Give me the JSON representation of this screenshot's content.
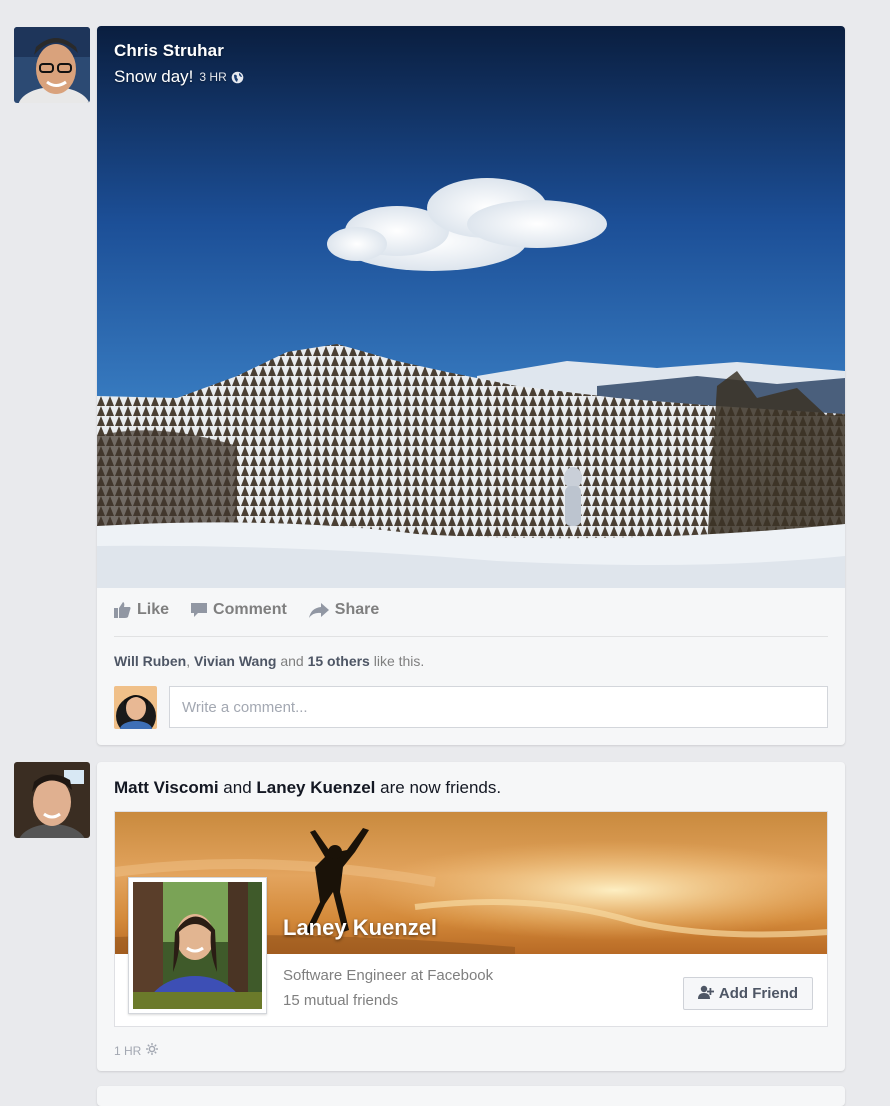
{
  "feed": {
    "story1": {
      "author": "Chris Struhar",
      "status": "Snow day!",
      "time": "3 HR",
      "privacy_icon": "globe-icon",
      "actions": {
        "like": "Like",
        "comment": "Comment",
        "share": "Share"
      },
      "likes": {
        "name1": "Will Ruben",
        "sep": ", ",
        "name2": "Vivian Wang",
        "and": " and ",
        "others": "15 others",
        "suffix": " like this."
      },
      "comment_placeholder": "Write a comment..."
    },
    "story2": {
      "actor1": "Matt Viscomi",
      "connector": " and ",
      "actor2": "Laney Kuenzel",
      "suffix": " are now friends.",
      "friend": {
        "name": "Laney Kuenzel",
        "job": "Software Engineer at Facebook",
        "mutual": "15 mutual friends",
        "add_label": "Add Friend"
      },
      "time": "1 HR",
      "privacy_icon": "friends-icon"
    }
  },
  "colors": {
    "background": "#e9eaed",
    "card": "#f6f7f8",
    "muted_text": "#7f7f7f",
    "text": "#141823"
  }
}
